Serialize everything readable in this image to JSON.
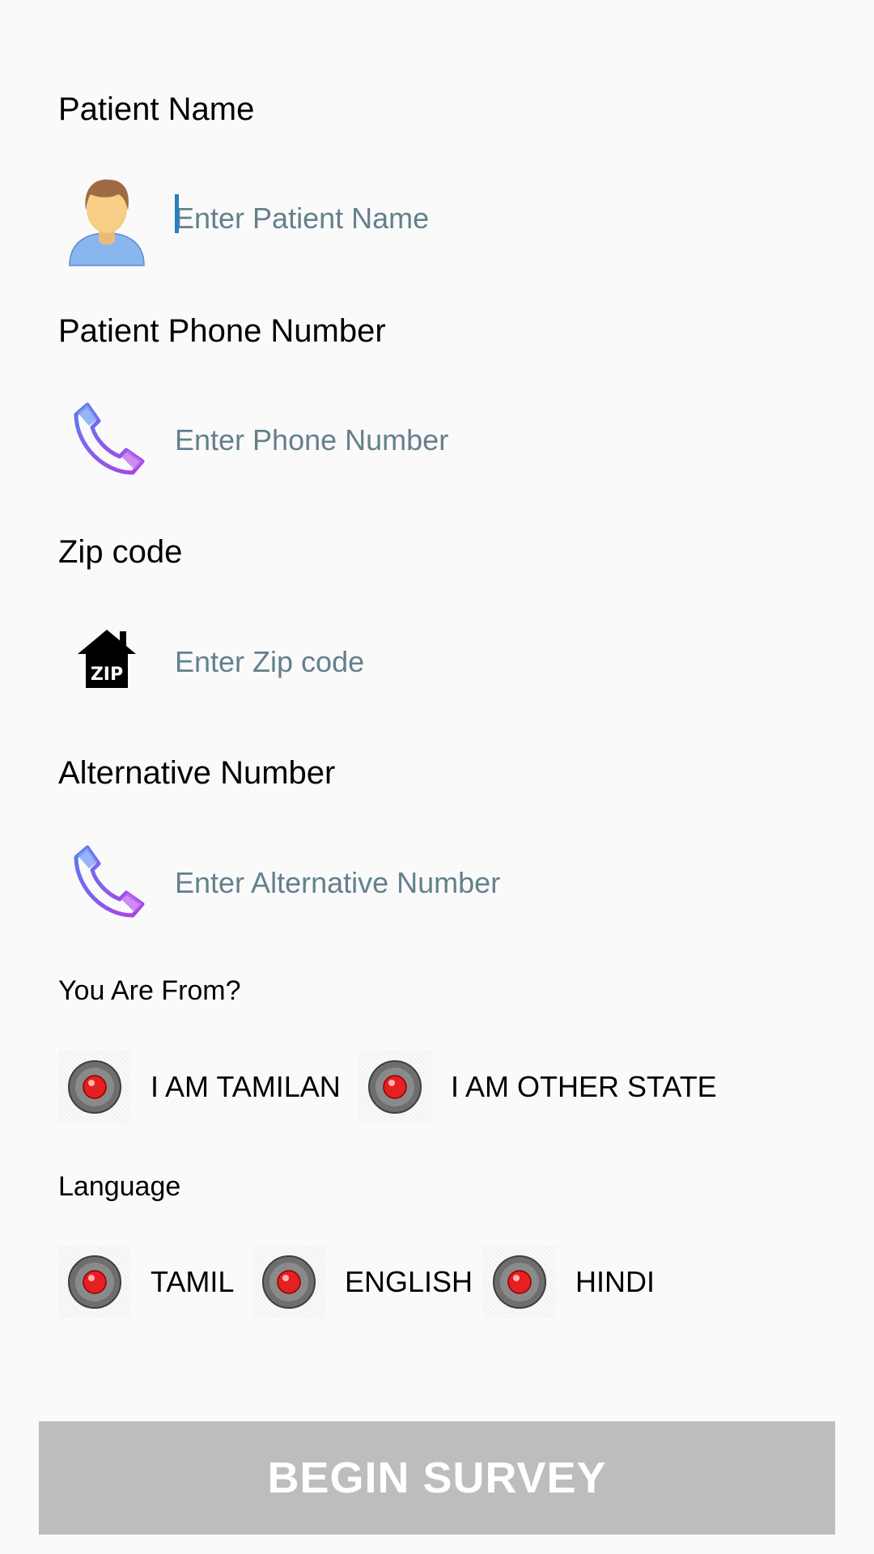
{
  "form": {
    "patient_name": {
      "label": "Patient Name",
      "placeholder": "Enter Patient Name",
      "value": "",
      "icon": "user-avatar-icon"
    },
    "phone": {
      "label": "Patient Phone Number",
      "placeholder": "Enter Phone Number",
      "value": "",
      "icon": "phone-icon"
    },
    "zip": {
      "label": "Zip code",
      "placeholder": "Enter Zip code",
      "value": "",
      "icon": "zip-house-icon"
    },
    "alt_phone": {
      "label": "Alternative Number",
      "placeholder": "Enter Alternative Number",
      "value": "",
      "icon": "phone-icon"
    }
  },
  "origin": {
    "label": "You Are From?",
    "options": [
      "I AM TAMILAN",
      "I AM OTHER STATE"
    ]
  },
  "language": {
    "label": "Language",
    "options": [
      "TAMIL",
      "ENGLISH",
      "HINDI"
    ]
  },
  "action": {
    "begin_label": "BEGIN SURVEY"
  },
  "colors": {
    "background": "#fafafa",
    "placeholder": "#64808c",
    "button_bg": "#bdbdbd",
    "button_text": "#ffffff",
    "radio_dot": "#e52020",
    "cursor": "#2a7fc0"
  }
}
